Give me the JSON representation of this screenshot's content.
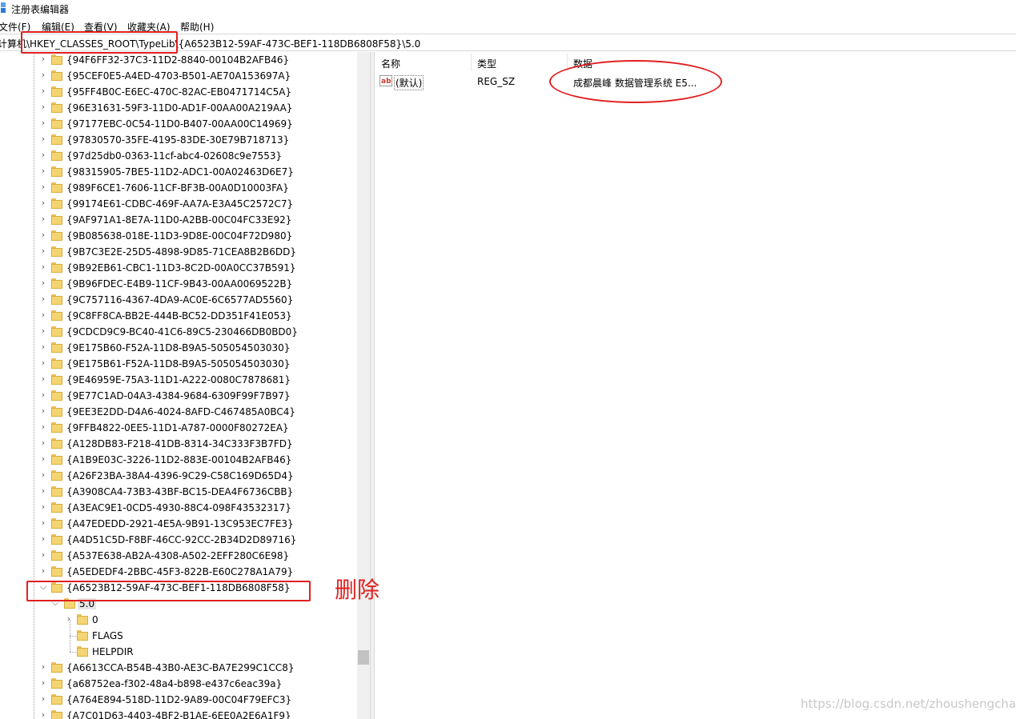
{
  "window": {
    "title": "注册表编辑器",
    "icon": "registry-editor-icon"
  },
  "menu": [
    {
      "label": "文件(F)"
    },
    {
      "label": "编辑(E)"
    },
    {
      "label": "查看(V)"
    },
    {
      "label": "收藏夹(A)"
    },
    {
      "label": "帮助(H)"
    }
  ],
  "address": {
    "path": "计算机\\HKEY_CLASSES_ROOT\\TypeLib\\{A6523B12-59AF-473C-BEF1-118DB6808F58}\\5.0"
  },
  "tree": {
    "items": [
      "{94F6FF32-37C3-11D2-8840-00104B2AFB46}",
      "{95CEF0E5-A4ED-4703-B501-AE70A153697A}",
      "{95FF4B0C-E6EC-470C-82AC-EB0471714C5A}",
      "{96E31631-59F3-11D0-AD1F-00AA00A219AA}",
      "{97177EBC-0C54-11D0-B407-00AA00C14969}",
      "{97830570-35FE-4195-83DE-30E79B718713}",
      "{97d25db0-0363-11cf-abc4-02608c9e7553}",
      "{98315905-7BE5-11D2-ADC1-00A02463D6E7}",
      "{989F6CE1-7606-11CF-BF3B-00A0D10003FA}",
      "{99174E61-CDBC-469F-AA7A-E3A45C2572C7}",
      "{9AF971A1-8E7A-11D0-A2BB-00C04FC33E92}",
      "{9B085638-018E-11D3-9D8E-00C04F72D980}",
      "{9B7C3E2E-25D5-4898-9D85-71CEA8B2B6DD}",
      "{9B92EB61-CBC1-11D3-8C2D-00A0CC37B591}",
      "{9B96FDEC-E4B9-11CF-9B43-00AA0069522B}",
      "{9C757116-4367-4DA9-AC0E-6C6577AD5560}",
      "{9C8FF8CA-BB2E-444B-BC52-DD351F41E053}",
      "{9CDCD9C9-BC40-41C6-89C5-230466DB0BD0}",
      "{9E175B60-F52A-11D8-B9A5-505054503030}",
      "{9E175B61-F52A-11D8-B9A5-505054503030}",
      "{9E46959E-75A3-11D1-A222-0080C7878681}",
      "{9E77C1AD-04A3-4384-9684-6309F99F7B97}",
      "{9EE3E2DD-D4A6-4024-8AFD-C467485A0BC4}",
      "{9FFB4822-0EE5-11D1-A787-0000F80272EA}",
      "{A128DB83-F218-41DB-8314-34C333F3B7FD}",
      "{A1B9E03C-3226-11D2-883E-00104B2AFB46}",
      "{A26F23BA-38A4-4396-9C29-C58C169D65D4}",
      "{A3908CA4-73B3-43BF-BC15-DEA4F6736CBB}",
      "{A3EAC9E1-0CD5-4930-88C4-098F43532317}",
      "{A47EDEDD-2921-4E5A-9B91-13C953EC7FE3}",
      "{A4D51C5D-F8BF-46CC-92CC-2B34D2D89716}",
      "{A537E638-AB2A-4308-A502-2EFF280C6E98}",
      "{A5EDEDF4-2BBC-45F3-822B-E60C278A1A79}"
    ],
    "expanded": {
      "label": "{A6523B12-59AF-473C-BEF1-118DB6808F58}",
      "child": {
        "label": "5.0",
        "children": [
          "0",
          "FLAGS",
          "HELPDIR"
        ]
      }
    },
    "items_after": [
      "{A6613CCA-B54B-43B0-AE3C-BA7E299C1CC8}",
      "{a68752ea-f302-48a4-b898-e437c6eac39a}",
      "{A764E894-518D-11D2-9A89-00C04F79EFC3}",
      "{A7C01D63-4403-4BF2-B1AE-6EE0A2E6A1F9}"
    ]
  },
  "list": {
    "columns": [
      "名称",
      "类型",
      "数据"
    ],
    "rows": [
      {
        "name": "(默认)",
        "type": "REG_SZ",
        "data": "成都晨峰 数据管理系统 E5..."
      }
    ]
  },
  "annotation": {
    "label": "删除",
    "color": "#e02020"
  },
  "watermark": "https://blog.csdn.net/zhoushengchao"
}
